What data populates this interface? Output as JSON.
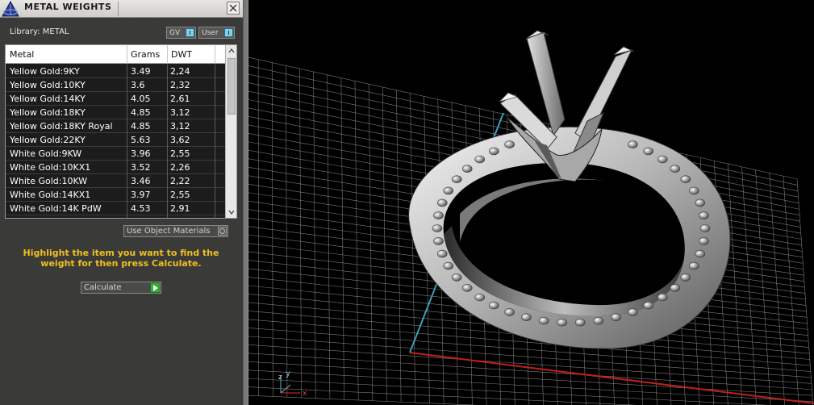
{
  "panel": {
    "title": "METAL WEIGHTS",
    "library_label": "Library: METAL",
    "toggles": [
      {
        "label": "GV"
      },
      {
        "label": "User"
      }
    ],
    "table": {
      "columns": [
        "Metal",
        "Grams",
        "DWT"
      ],
      "rows": [
        {
          "metal": "Yellow Gold:9KY",
          "grams": "3.49",
          "dwt": "2,24"
        },
        {
          "metal": "Yellow Gold:10KY",
          "grams": "3.6",
          "dwt": "2,32"
        },
        {
          "metal": "Yellow Gold:14KY",
          "grams": "4.05",
          "dwt": "2,61"
        },
        {
          "metal": "Yellow Gold:18KY",
          "grams": "4.85",
          "dwt": "3,12"
        },
        {
          "metal": "Yellow Gold:18KY Royal",
          "grams": "4.85",
          "dwt": "3,12"
        },
        {
          "metal": "Yellow Gold:22KY",
          "grams": "5.63",
          "dwt": "3,62"
        },
        {
          "metal": "White Gold:9KW",
          "grams": "3.96",
          "dwt": "2,55"
        },
        {
          "metal": "White Gold:10KX1",
          "grams": "3.52",
          "dwt": "2,26"
        },
        {
          "metal": "White Gold:10KW",
          "grams": "3.46",
          "dwt": "2,22"
        },
        {
          "metal": "White Gold:14KX1",
          "grams": "3.97",
          "dwt": "2,55"
        },
        {
          "metal": "White Gold:14K PdW",
          "grams": "4.53",
          "dwt": "2,91"
        }
      ]
    },
    "use_object_materials_label": "Use Object Materials",
    "hint_text": "Highlight the item you want to find the weight for then press Calculate.",
    "calculate_label": "Calculate"
  },
  "viewport": {
    "axis_labels": {
      "y": "y",
      "z": "z",
      "x": "x"
    },
    "colors": {
      "grid": "#a0a0a0",
      "x_axis": "#c0201a",
      "y_axis": "#3aa0b8",
      "hint": "#f0c020"
    }
  }
}
